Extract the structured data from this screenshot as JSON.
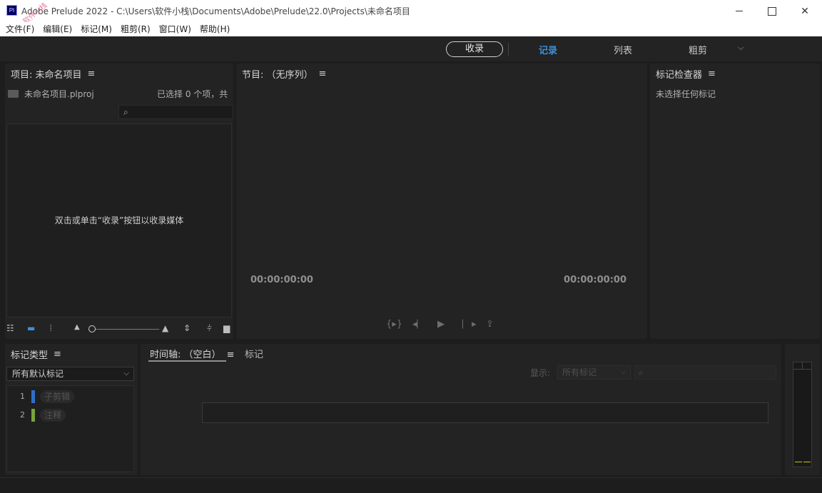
{
  "window": {
    "app_icon": "Pl",
    "title": "Adobe Prelude 2022 - C:\\Users\\软件小栈\\Documents\\Adobe\\Prelude\\22.0\\Projects\\未命名项目",
    "watermark": "公众号: 软件小栈"
  },
  "menu": [
    "文件(F)",
    "编辑(E)",
    "标记(M)",
    "粗剪(R)",
    "窗口(W)",
    "帮助(H)"
  ],
  "workspace": {
    "ingest_label": "收录",
    "tabs": [
      "记录",
      "列表",
      "粗剪"
    ],
    "active_tab": "记录",
    "more_icon": "chevron-down-icon"
  },
  "project": {
    "title": "项目: 未命名项目",
    "file_name": "未命名项目.plproj",
    "selection_count": "已选择 0 个项，共",
    "empty_message": "双击或单击“收录”按钮以收录媒体"
  },
  "program": {
    "title": "节目: （无序列）",
    "timecode_in": "00:00:00:00",
    "timecode_out": "00:00:00:00"
  },
  "inspector": {
    "title": "标记检查器",
    "empty_message": "未选择任何标记"
  },
  "marker_types": {
    "title": "标记类型",
    "selected": "所有默认标记",
    "items": [
      {
        "num": "1",
        "label": "子剪辑",
        "color": "#2e6fc9"
      },
      {
        "num": "2",
        "label": "注释",
        "color": "#7aa33c"
      }
    ]
  },
  "timeline": {
    "tab_label": "时间轴: （空白）",
    "tab_markers": "标记",
    "show_label": "显示:",
    "show_value": "所有标记"
  }
}
